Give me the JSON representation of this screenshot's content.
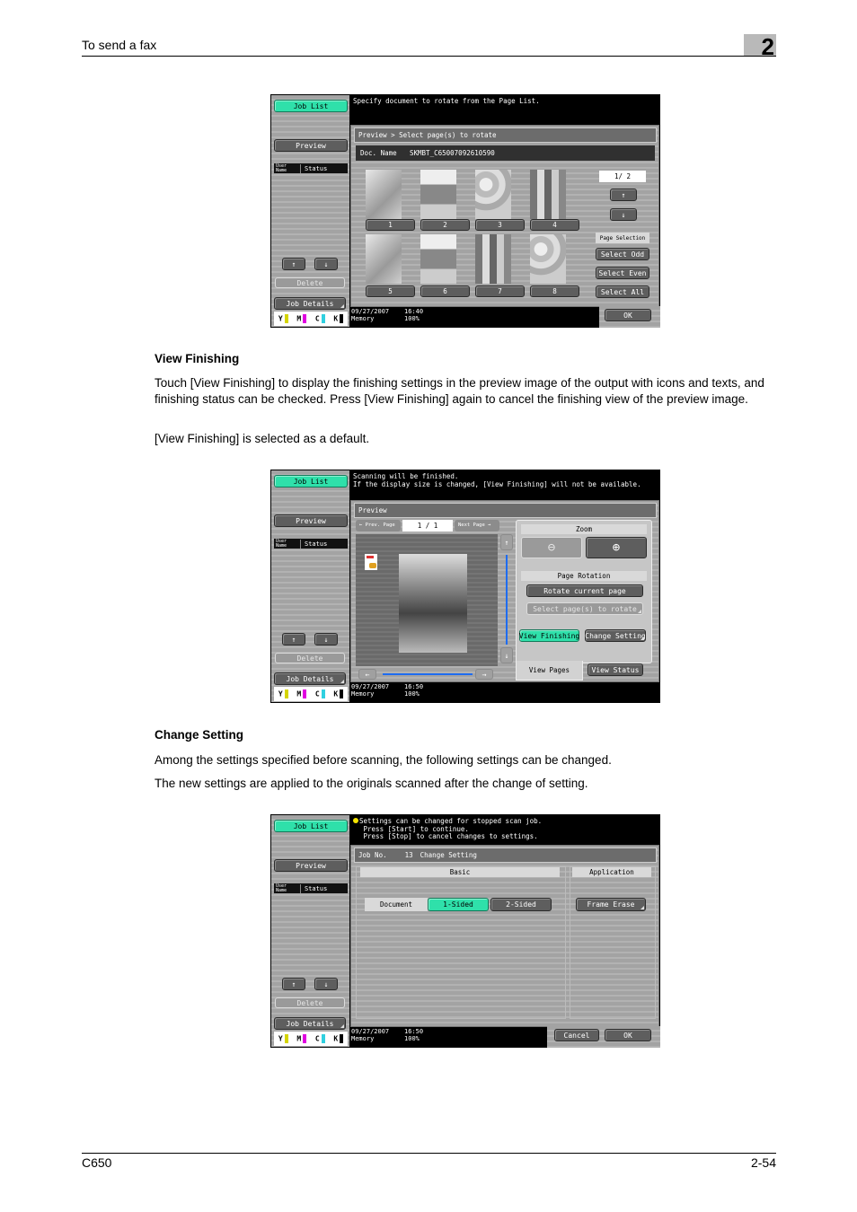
{
  "header": {
    "section_title": "To send a fax",
    "chapter_number": "2"
  },
  "footer": {
    "model": "C650",
    "page_number": "2-54"
  },
  "sections": {
    "view_finishing": {
      "heading": "View Finishing",
      "para1": "Touch [View Finishing] to display the finishing settings in the preview image of the output with icons and texts, and finishing status can be checked. Press [View Finishing] again to cancel the finishing view of the preview image.",
      "para2": "[View Finishing] is selected as a default."
    },
    "change_setting": {
      "heading": "Change Setting",
      "para1": "Among the settings specified before scanning, the following settings can be changed.",
      "para2": "The new settings are applied to the originals scanned after the change of setting."
    }
  },
  "common_left": {
    "job_list": "Job List",
    "preview": "Preview",
    "user_name": "User Name",
    "status": "Status",
    "up_arrow": "↑",
    "down_arrow": "↓",
    "delete": "Delete",
    "job_details": "Job Details",
    "toner": [
      {
        "label": "Y",
        "color": "#d4d400"
      },
      {
        "label": "M",
        "color": "#e000e0"
      },
      {
        "label": "C",
        "color": "#30d0e0"
      },
      {
        "label": "K",
        "color": "#000000"
      }
    ]
  },
  "screen1": {
    "message": "Specify document to rotate from the Page List.",
    "breadcrumb": "Preview > Select page(s) to rotate",
    "doc_name_label": "Doc. Name",
    "doc_name_value": "SKMBT_C65007092610590",
    "page_counter": "1/  2",
    "page_buttons": [
      "1",
      "2",
      "3",
      "4",
      "5",
      "6",
      "7",
      "8"
    ],
    "page_selection_label": "Page Selection",
    "select_odd": "Select Odd",
    "select_even": "Select Even",
    "select_all": "Select All",
    "ok": "OK",
    "date": "09/27/2007",
    "time": "16:40",
    "memory_label": "Memory",
    "memory_value": "100%"
  },
  "screen2": {
    "message": "Scanning will be finished.\nIf the display size is changed, [View Finishing] will not be available.",
    "breadcrumb": "Preview",
    "prev_page": "Prev. Page",
    "next_page": "Next Page",
    "page_counter": "1 /     1",
    "zoom_label": "Zoom",
    "page_rotation_label": "Page Rotation",
    "rotate_current": "Rotate current page",
    "select_rotate": "Select page(s) to rotate",
    "view_finishing": "View Finishing",
    "change_setting": "Change Setting",
    "view_pages": "View Pages",
    "view_status": "View Status",
    "date": "09/27/2007",
    "time": "16:50",
    "memory_label": "Memory",
    "memory_value": "100%"
  },
  "screen3": {
    "message": "Settings can be changed for stopped scan job.\n Press [Start] to continue.\n Press [Stop] to cancel changes to settings.",
    "job_no_label": "Job No.",
    "job_no_value": "13",
    "title": "Change Setting",
    "basic_label": "Basic",
    "application_label": "Application",
    "document_label": "Document",
    "one_sided": "1-Sided",
    "two_sided": "2-Sided",
    "frame_erase": "Frame Erase",
    "cancel": "Cancel",
    "ok": "OK",
    "date": "09/27/2007",
    "time": "16:50",
    "memory_label": "Memory",
    "memory_value": "100%"
  }
}
